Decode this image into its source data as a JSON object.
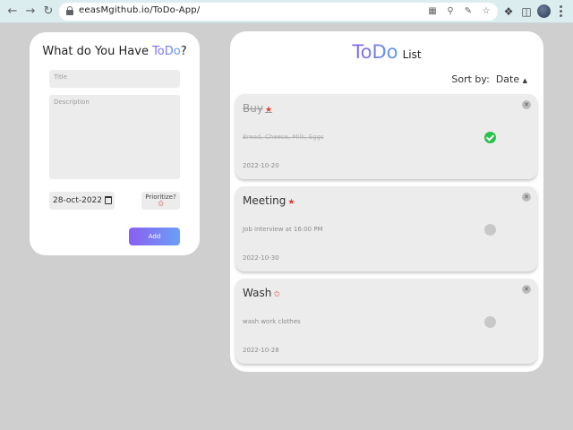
{
  "browser": {
    "url": "eeasMgithub.io/ToDo-App/",
    "colors": {
      "toolbar": "#dcedef"
    }
  },
  "form": {
    "heading_prefix": "What do You Have ",
    "heading_accent": "ToDo",
    "heading_suffix": "?",
    "title_placeholder": "Title",
    "description_placeholder": "Description",
    "date_value": "28-oct-2022",
    "prioritize_label": "Prioritize?",
    "add_label": "Add"
  },
  "list": {
    "title_big": "ToDo",
    "title_small": "List",
    "sort_label": "Sort by:",
    "sort_value": "Date",
    "items": [
      {
        "title": "Buy",
        "description": "Bread, Cheese, Milk, Eggs",
        "date": "2022-10-20",
        "prioritized": true,
        "completed": true
      },
      {
        "title": "Meeting",
        "description": "Job interview at 16:00 PM",
        "date": "2022-10-30",
        "prioritized": true,
        "completed": false
      },
      {
        "title": "Wash",
        "description": "wash work clothes",
        "date": "2022-10-28",
        "prioritized": false,
        "completed": false
      }
    ]
  },
  "colors": {
    "accent_start": "#8a63e8",
    "accent_end": "#5a9cf0",
    "priority_star": "#e53935",
    "done_check": "#27c24a",
    "background": "#cfcfcf"
  }
}
